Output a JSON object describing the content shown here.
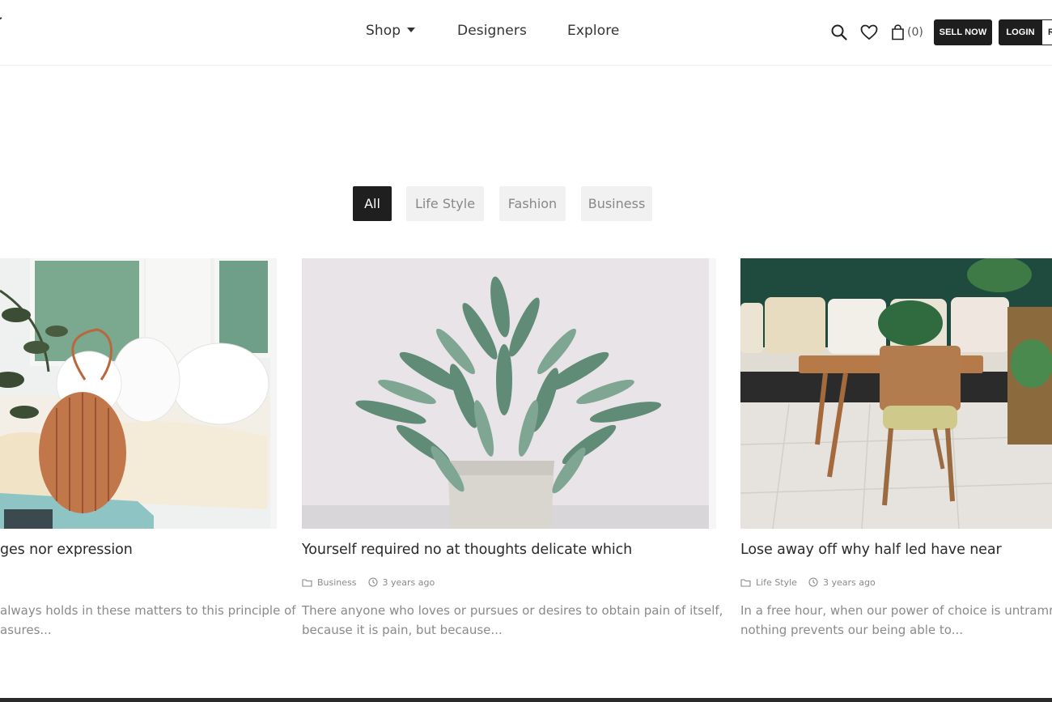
{
  "header": {
    "nav": [
      {
        "label": "Shop",
        "has_dropdown": true
      },
      {
        "label": "Designers"
      },
      {
        "label": "Explore"
      }
    ],
    "icons": [
      "search-icon",
      "heart-icon",
      "bag-icon"
    ],
    "cart_count": "(0)",
    "sell_label": "SELL NOW",
    "login_label": "LOGIN",
    "register_partial": "R"
  },
  "filters": [
    {
      "label": "All",
      "active": true
    },
    {
      "label": "Life Style",
      "active": false
    },
    {
      "label": "Fashion",
      "active": false
    },
    {
      "label": "Business",
      "active": false
    }
  ],
  "posts": [
    {
      "title": "ges nor expression",
      "excerpt_line1": "always holds in these matters to this principle of",
      "excerpt_line2": "asures..."
    },
    {
      "title": "Yourself required no at thoughts delicate which",
      "category": "Business",
      "time": "3 years ago",
      "excerpt_line1": "There anyone who loves or pursues or desires to obtain pain of itself,",
      "excerpt_line2": "because it is pain, but because..."
    },
    {
      "title": "Lose away off why half led have near",
      "category": "Life Style",
      "time": "3 years ago",
      "excerpt_line1": "In a free hour, when our power of choice is untrammelled",
      "excerpt_line2": "nothing prevents our being able to..."
    }
  ],
  "colors": {
    "dark": "#1e1e1e",
    "filter_bg": "#f1f1f1",
    "muted_text": "#8a8a8a"
  }
}
